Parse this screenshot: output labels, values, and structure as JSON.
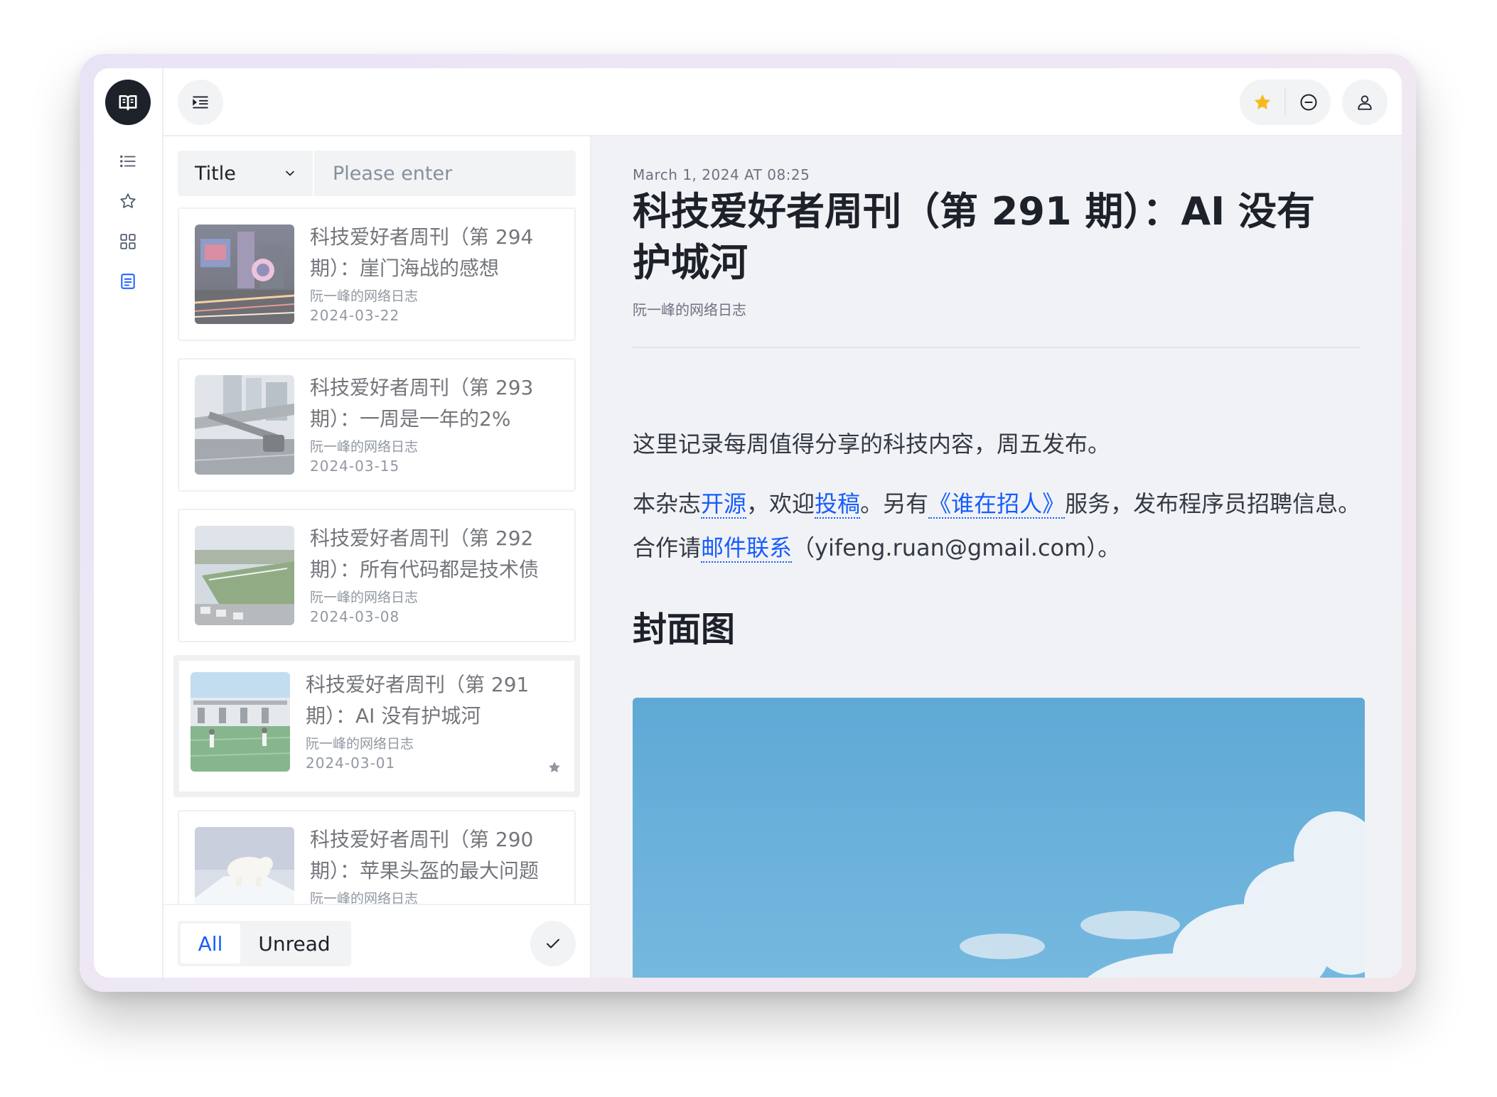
{
  "toolbar": {
    "menu_icon": "indent-menu-icon",
    "star_icon": "star-filled-icon",
    "star_color": "#f7ba1e",
    "minus_icon": "minus-circle-icon",
    "user_icon": "user-icon"
  },
  "rail": {
    "logo_icon": "open-book-icon",
    "items": [
      {
        "icon": "list-icon"
      },
      {
        "icon": "star-icon"
      },
      {
        "icon": "grid-icon"
      },
      {
        "icon": "document-icon"
      }
    ],
    "active_color": "#165dff"
  },
  "search": {
    "field": "Title",
    "placeholder": "Please enter"
  },
  "articles": [
    {
      "title": "科技爱好者周刊（第 294 期）：崖门海战的感想",
      "feed": "阮一峰的网络日志",
      "date": "2024-03-22",
      "starred": false
    },
    {
      "title": "科技爱好者周刊（第 293 期）：一周是一年的2%",
      "feed": "阮一峰的网络日志",
      "date": "2024-03-15",
      "starred": false
    },
    {
      "title": "科技爱好者周刊（第 292 期）：所有代码都是技术债",
      "feed": "阮一峰的网络日志",
      "date": "2024-03-08",
      "starred": false
    },
    {
      "title": "科技爱好者周刊（第 291 期）：AI 没有护城河",
      "feed": "阮一峰的网络日志",
      "date": "2024-03-01",
      "starred": true
    },
    {
      "title": "科技爱好者周刊（第 290 期）：苹果头盔的最大问题",
      "feed": "阮一峰的网络日志",
      "date": "",
      "starred": false
    }
  ],
  "filter": {
    "all_label": "All",
    "unread_label": "Unread",
    "mark_read_icon": "check-icon"
  },
  "article": {
    "date": "March 1, 2024 AT 08:25",
    "title": "科技爱好者周刊（第 291 期）：AI 没有护城河",
    "feed": "阮一峰的网络日志",
    "intro": "这里记录每周值得分享的科技内容，周五发布。",
    "p2": {
      "t1": "本杂志",
      "l1": "开源",
      "t2": "，欢迎",
      "l2": "投稿",
      "t3": "。另有",
      "l3": "《谁在招人》",
      "t4": "服务，发布程序员招聘信息。合作请",
      "l4": "邮件联系",
      "t5": "（yifeng.ruan@gmail.com）。"
    },
    "section_heading": "封面图"
  },
  "colors": {
    "accent": "#165dff",
    "text_primary": "#1d2129",
    "article_bg": "#f1f2f5"
  }
}
